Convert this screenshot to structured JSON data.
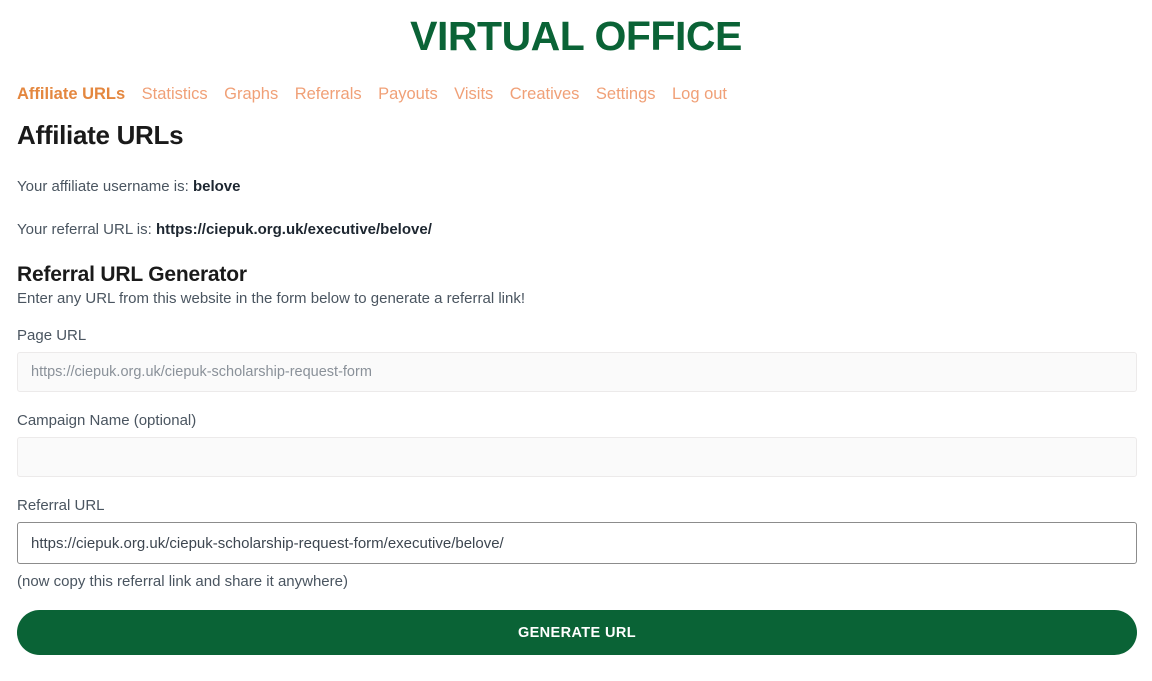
{
  "header": {
    "title": "VIRTUAL OFFICE"
  },
  "nav": {
    "items": [
      {
        "label": "Affiliate URLs",
        "active": true
      },
      {
        "label": "Statistics",
        "active": false
      },
      {
        "label": "Graphs",
        "active": false
      },
      {
        "label": "Referrals",
        "active": false
      },
      {
        "label": "Payouts",
        "active": false
      },
      {
        "label": "Visits",
        "active": false
      },
      {
        "label": "Creatives",
        "active": false
      },
      {
        "label": "Settings",
        "active": false
      },
      {
        "label": "Log out",
        "active": false
      }
    ]
  },
  "main": {
    "page_heading": "Affiliate URLs",
    "username_line": {
      "prefix": "Your affiliate username is: ",
      "value": "belove"
    },
    "referral_line": {
      "prefix": "Your referral URL is: ",
      "value": "https://ciepuk.org.uk/executive/belove/"
    },
    "generator": {
      "heading": "Referral URL Generator",
      "subtitle": "Enter any URL from this website in the form below to generate a referral link!",
      "page_url": {
        "label": "Page URL",
        "value": "",
        "placeholder": "https://ciepuk.org.uk/ciepuk-scholarship-request-form"
      },
      "campaign_name": {
        "label": "Campaign Name (optional)",
        "value": "",
        "placeholder": ""
      },
      "referral_url": {
        "label": "Referral URL",
        "value": "https://ciepuk.org.uk/ciepuk-scholarship-request-form/executive/belove/",
        "placeholder": ""
      },
      "hint": "(now copy this referral link and share it anywhere)",
      "generate_button": "Generate URL"
    }
  },
  "colors": {
    "brand_green": "#0a6336",
    "nav_active": "#e4873f",
    "nav_inactive": "#f0a077",
    "body_text": "#4a5560"
  }
}
